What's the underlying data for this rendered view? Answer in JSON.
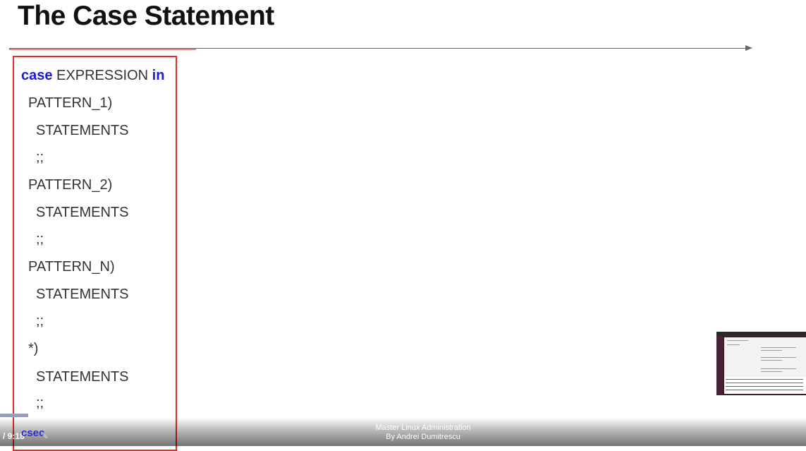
{
  "slide": {
    "title": "The Case Statement"
  },
  "code": {
    "keyword_case": "case",
    "expression": " EXPRESSION ",
    "keyword_in": "in",
    "lines": [
      "PATTERN_1)",
      "STATEMENTS",
      ";;",
      "PATTERN_2)",
      "STATEMENTS",
      ";;",
      "PATTERN_N)",
      "STATEMENTS",
      ";;",
      "*)",
      "STATEMENTS",
      ";;"
    ]
  },
  "player": {
    "time": "/ 9:18",
    "logo": "csec",
    "credit_line1": "Master Linux Administration",
    "credit_line2": "By Andrei Dumitrescu"
  },
  "colors": {
    "keyword": "#1a1adf",
    "box_border": "#e0302a",
    "code_text": "#333333"
  }
}
